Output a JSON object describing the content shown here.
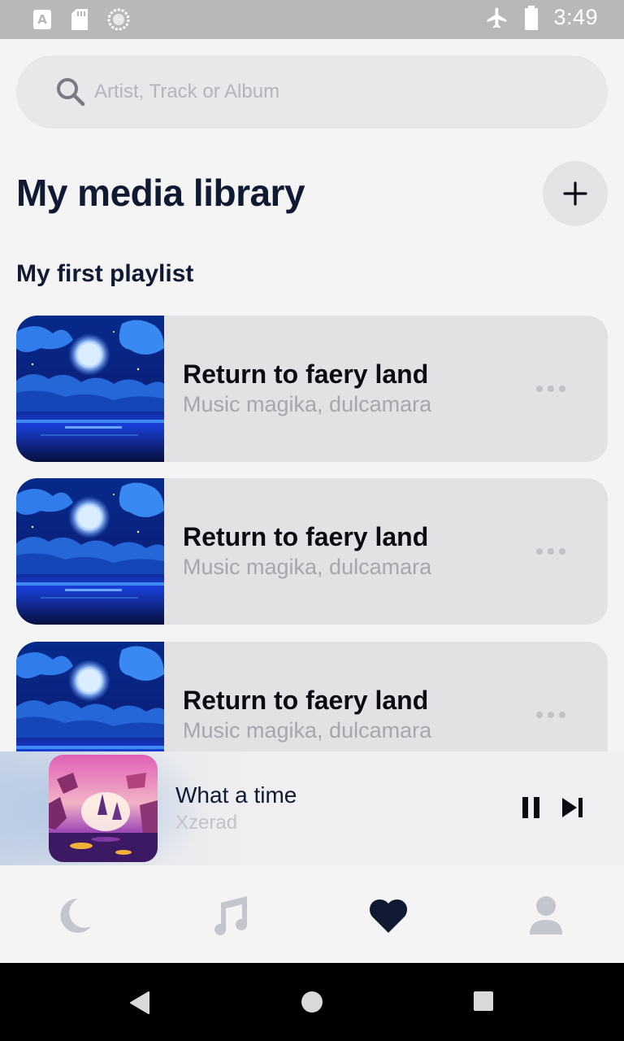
{
  "status_bar": {
    "time": "3:49",
    "icons": [
      "keyboard-a-icon",
      "sd-card-icon",
      "sync-circle-icon",
      "airplane-mode-icon",
      "battery-icon"
    ]
  },
  "search": {
    "placeholder": "Artist, Track or Album",
    "value": "",
    "icon": "search-icon"
  },
  "library": {
    "title": "My media library",
    "add_icon": "plus-icon"
  },
  "playlist": {
    "title": "My first playlist",
    "tracks": [
      {
        "title": "Return to faery land",
        "artist": "Music magika, dulcamara"
      },
      {
        "title": "Return to faery land",
        "artist": "Music magika, dulcamara"
      },
      {
        "title": "Return to faery land",
        "artist": "Music magika, dulcamara"
      }
    ]
  },
  "now_playing": {
    "title": "What a time",
    "artist": "Xzerad",
    "controls": [
      "pause-icon",
      "skip-next-icon"
    ]
  },
  "tabs": [
    {
      "name": "moon-icon",
      "active": false
    },
    {
      "name": "music-note-icon",
      "active": false
    },
    {
      "name": "heart-icon",
      "active": true
    },
    {
      "name": "user-icon",
      "active": false
    }
  ],
  "colors": {
    "primary_text": "#111a33",
    "secondary_text": "#a6a6ad",
    "tab_inactive": "#c3c6cc",
    "tab_active": "#111a33",
    "card_bg": "#e2e2e5"
  }
}
